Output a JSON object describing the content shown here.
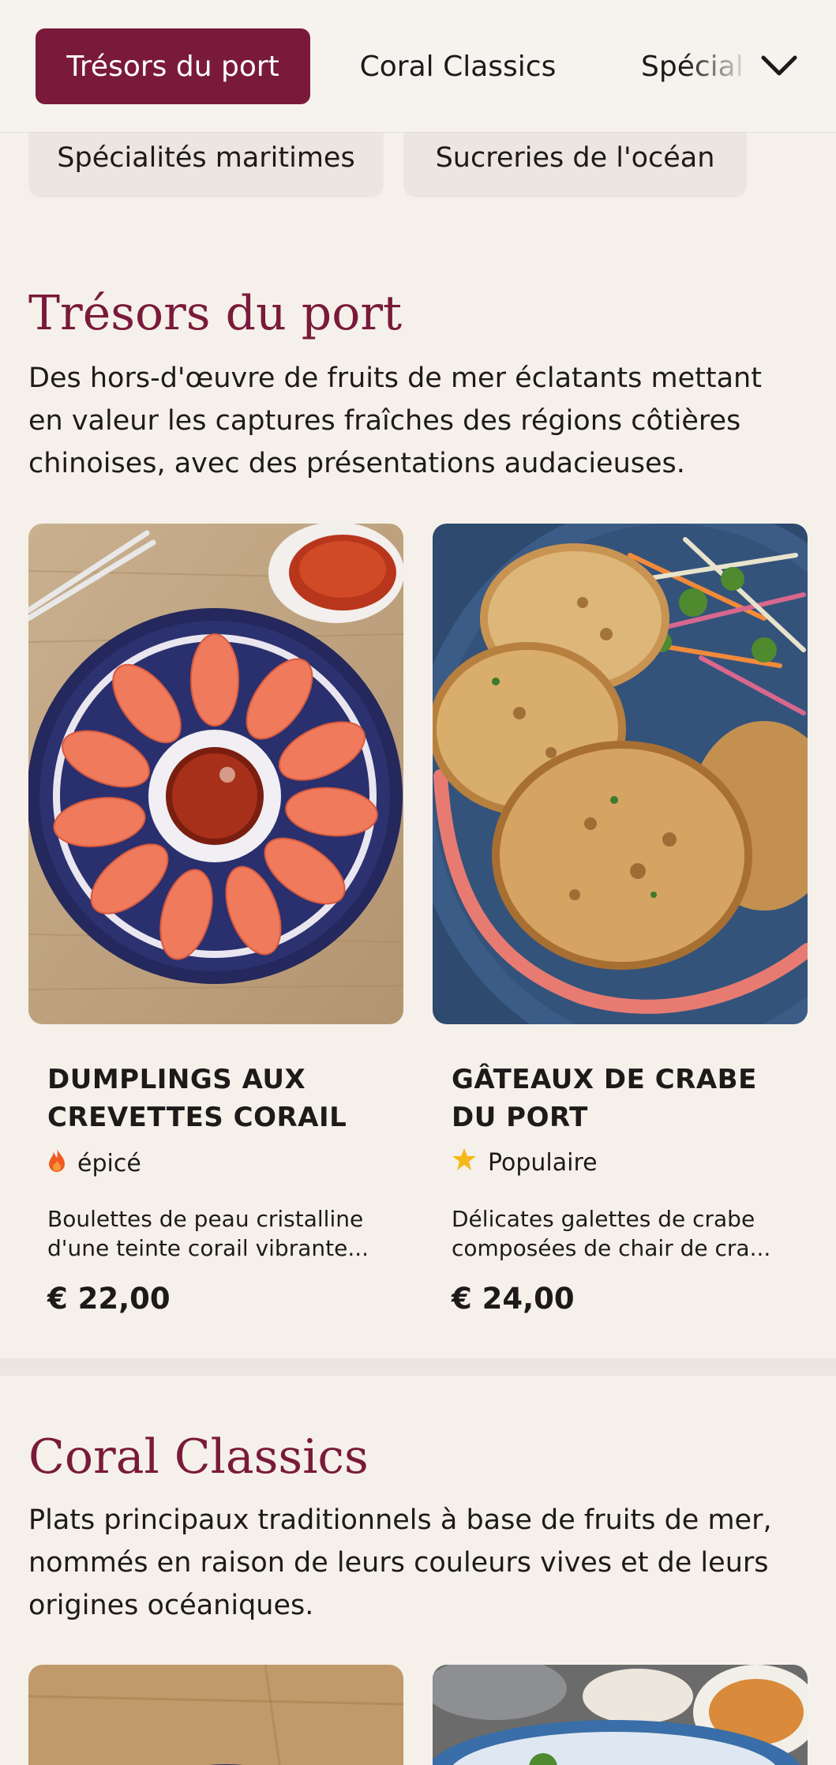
{
  "nav": {
    "tabs": [
      "Trésors du port",
      "Coral Classics",
      "Spécial"
    ],
    "more_icon": "chevron-down-icon"
  },
  "overflow_chips": [
    "Spécialités maritimes",
    "Sucreries de l'océan"
  ],
  "sections": [
    {
      "title": "Trésors du port",
      "description": "Des hors-d'œuvre de fruits de mer éclatants mettant en valeur les captures fraîches des régions côtières chinoises, avec des présentations audacieuses.",
      "items": [
        {
          "name": "DUMPLINGS AUX CREVETTES CORAIL",
          "tag_icon": "flame-icon",
          "tag": "épicé",
          "description": "Boulettes de peau cristalline d'une teinte corail vibrante...",
          "price": "€ 22,00"
        },
        {
          "name": "GÂTEAUX DE CRABE DU PORT",
          "tag_icon": "star-icon",
          "tag": "Populaire",
          "description": "Délicates galettes de crabe composées de chair de cra...",
          "price": "€ 24,00"
        }
      ]
    },
    {
      "title": "Coral Classics",
      "description": "Plats principaux traditionnels à base de fruits de mer, nommés en raison de leurs couleurs vives et de leurs origines océaniques."
    }
  ],
  "colors": {
    "accent": "#7a1a3a",
    "background": "#f5f1ea",
    "chip": "#ece6e0",
    "flame": "#f05a22",
    "star": "#f6b91a"
  }
}
